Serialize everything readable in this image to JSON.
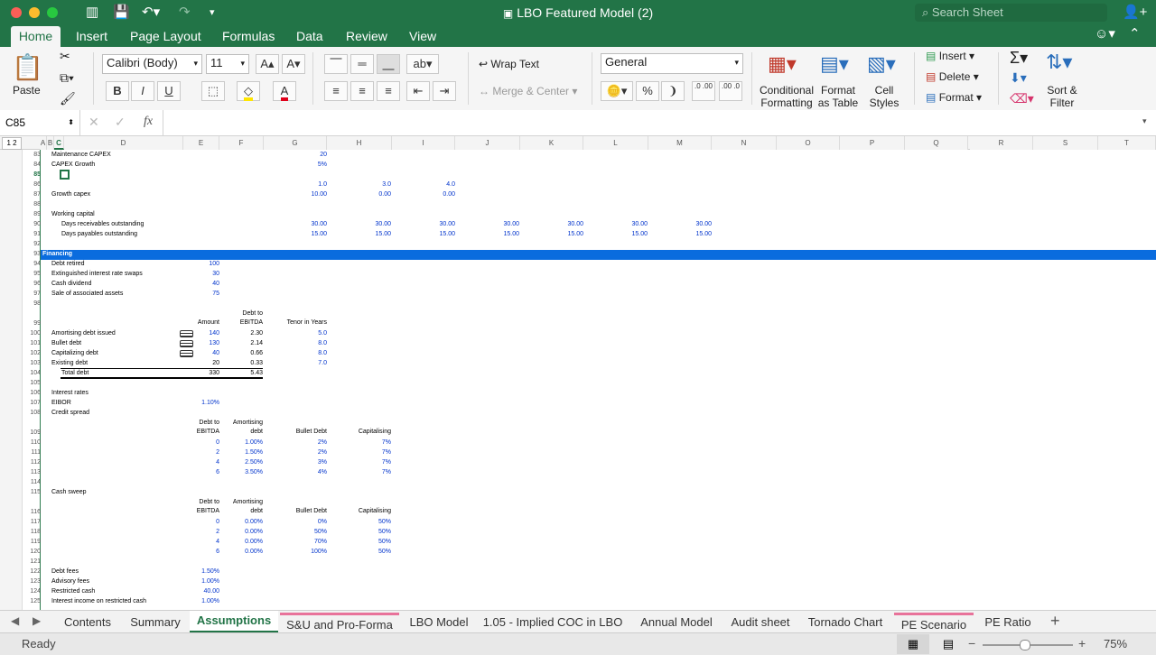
{
  "window": {
    "title": "LBO Featured Model (2)",
    "search_placeholder": "Search Sheet"
  },
  "ribbon_tabs": [
    "Home",
    "Insert",
    "Page Layout",
    "Formulas",
    "Data",
    "Review",
    "View"
  ],
  "ribbon": {
    "paste": "Paste",
    "font_name": "Calibri (Body)",
    "font_size": "11",
    "bold": "B",
    "italic": "I",
    "underline": "U",
    "wrap_text": "Wrap Text",
    "merge_center": "Merge & Center",
    "number_format": "General",
    "percent": "%",
    "comma": "❩",
    "inc_decimal": ".0 .00",
    "dec_decimal": ".00 .0",
    "conditional_formatting": [
      "Conditional",
      "Formatting"
    ],
    "format_as_table": [
      "Format",
      "as Table"
    ],
    "cell_styles": [
      "Cell",
      "Styles"
    ],
    "insert": "Insert",
    "delete": "Delete",
    "format": "Format",
    "sort_filter": [
      "Sort &",
      "Filter"
    ]
  },
  "formula_bar": {
    "name_box": "C85",
    "fx": "fx",
    "content": ""
  },
  "outline_levels": "1 2",
  "columns": [
    "A",
    "B",
    "C",
    "D",
    "E",
    "F",
    "G",
    "H",
    "I",
    "J",
    "K",
    "L",
    "M",
    "N",
    "O",
    "P",
    "Q",
    "R",
    "S",
    "T"
  ],
  "rows": [
    {
      "n": "83",
      "cells": [
        {
          "c": "D",
          "t": "Maintenance CAPEX"
        },
        {
          "c": "G",
          "t": "20",
          "blue": true
        }
      ]
    },
    {
      "n": "84",
      "cells": [
        {
          "c": "D",
          "t": "CAPEX Growth"
        },
        {
          "c": "G",
          "t": "5%",
          "blue": true
        }
      ]
    },
    {
      "n": "85",
      "cells": []
    },
    {
      "n": "86",
      "cells": [
        {
          "c": "G",
          "t": "1.0",
          "blue": true
        },
        {
          "c": "H",
          "t": "3.0",
          "blue": true
        },
        {
          "c": "I",
          "t": "4.0",
          "blue": true
        }
      ]
    },
    {
      "n": "87",
      "cells": [
        {
          "c": "D",
          "t": "Growth capex"
        },
        {
          "c": "G",
          "t": "10.00",
          "blue": true
        },
        {
          "c": "H",
          "t": "0.00",
          "blue": true
        },
        {
          "c": "I",
          "t": "0.00",
          "blue": true
        }
      ]
    },
    {
      "n": "88",
      "cells": []
    },
    {
      "n": "89",
      "cells": [
        {
          "c": "D",
          "t": "Working capital"
        }
      ]
    },
    {
      "n": "90",
      "cells": [
        {
          "c": "D2",
          "t": "Days receivables outstanding"
        },
        {
          "c": "G",
          "t": "30.00",
          "blue": true
        },
        {
          "c": "H",
          "t": "30.00",
          "blue": true
        },
        {
          "c": "I",
          "t": "30.00",
          "blue": true
        },
        {
          "c": "J",
          "t": "30.00",
          "blue": true
        },
        {
          "c": "K",
          "t": "30.00",
          "blue": true
        },
        {
          "c": "L",
          "t": "30.00",
          "blue": true
        },
        {
          "c": "M",
          "t": "30.00",
          "blue": true
        }
      ]
    },
    {
      "n": "91",
      "cells": [
        {
          "c": "D2",
          "t": "Days payables outstanding"
        },
        {
          "c": "G",
          "t": "15.00",
          "blue": true
        },
        {
          "c": "H",
          "t": "15.00",
          "blue": true
        },
        {
          "c": "I",
          "t": "15.00",
          "blue": true
        },
        {
          "c": "J",
          "t": "15.00",
          "blue": true
        },
        {
          "c": "K",
          "t": "15.00",
          "blue": true
        },
        {
          "c": "L",
          "t": "15.00",
          "blue": true
        },
        {
          "c": "M",
          "t": "15.00",
          "blue": true
        }
      ]
    },
    {
      "n": "92",
      "cells": []
    },
    {
      "n": "93",
      "header": "Financing",
      "cells": []
    },
    {
      "n": "94",
      "cells": [
        {
          "c": "D",
          "t": "Debt retired"
        },
        {
          "c": "E",
          "t": "100",
          "blue": true
        }
      ]
    },
    {
      "n": "95",
      "cells": [
        {
          "c": "D",
          "t": "Extinguished interest rate swaps"
        },
        {
          "c": "E",
          "t": "30",
          "blue": true
        }
      ]
    },
    {
      "n": "96",
      "cells": [
        {
          "c": "D",
          "t": "Cash dividend"
        },
        {
          "c": "E",
          "t": "40",
          "blue": true
        }
      ]
    },
    {
      "n": "97",
      "cells": [
        {
          "c": "D",
          "t": "Sale of associated assets"
        },
        {
          "c": "E",
          "t": "75",
          "blue": true
        }
      ]
    },
    {
      "n": "98",
      "cells": []
    },
    {
      "n": "99",
      "tall": true,
      "cells": [
        {
          "c": "E",
          "t": "Amount"
        },
        {
          "c": "F",
          "t": "Debt to"
        },
        {
          "c": "F2",
          "t": "EBITDA"
        },
        {
          "c": "G",
          "t": "Tenor in Years"
        }
      ]
    },
    {
      "n": "100",
      "cells": [
        {
          "c": "D",
          "t": "Amortising debt issued"
        },
        {
          "c": "E",
          "t": "140",
          "blue": true
        },
        {
          "c": "F",
          "t": "2.30"
        },
        {
          "c": "G",
          "t": "5.0",
          "blue": true
        }
      ]
    },
    {
      "n": "101",
      "cells": [
        {
          "c": "D",
          "t": "Bullet debt"
        },
        {
          "c": "E",
          "t": "130",
          "blue": true
        },
        {
          "c": "F",
          "t": "2.14"
        },
        {
          "c": "G",
          "t": "8.0",
          "blue": true
        }
      ]
    },
    {
      "n": "102",
      "cells": [
        {
          "c": "D",
          "t": "Capitalizing debt"
        },
        {
          "c": "E",
          "t": "40",
          "blue": true
        },
        {
          "c": "F",
          "t": "0.66"
        },
        {
          "c": "G",
          "t": "8.0",
          "blue": true
        }
      ]
    },
    {
      "n": "103",
      "cells": [
        {
          "c": "D",
          "t": "Existing debt"
        },
        {
          "c": "E",
          "t": "20"
        },
        {
          "c": "F",
          "t": "0.33"
        },
        {
          "c": "G",
          "t": "7.0",
          "blue": true
        }
      ]
    },
    {
      "n": "104",
      "total": true,
      "cells": [
        {
          "c": "D2",
          "t": "Total debt"
        },
        {
          "c": "E",
          "t": "330"
        },
        {
          "c": "F",
          "t": "5.43"
        }
      ]
    },
    {
      "n": "105",
      "cells": []
    },
    {
      "n": "106",
      "cells": [
        {
          "c": "D",
          "t": "Interest rates"
        }
      ]
    },
    {
      "n": "107",
      "cells": [
        {
          "c": "D",
          "t": "EIBOR"
        },
        {
          "c": "E",
          "t": "1.10%",
          "blue": true
        }
      ]
    },
    {
      "n": "108",
      "cells": [
        {
          "c": "D",
          "t": "Credit spread"
        }
      ]
    },
    {
      "n": "109",
      "tall": true,
      "cells": [
        {
          "c": "E",
          "t": "Debt to"
        },
        {
          "c": "E2",
          "t": "EBITDA"
        },
        {
          "c": "F",
          "t": "Amortising"
        },
        {
          "c": "F2",
          "t": "debt"
        },
        {
          "c": "G",
          "t": "Bullet Debt"
        },
        {
          "c": "H",
          "t": "Capitalising"
        }
      ]
    },
    {
      "n": "110",
      "cells": [
        {
          "c": "E",
          "t": "0",
          "blue": true
        },
        {
          "c": "F",
          "t": "1.00%",
          "blue": true
        },
        {
          "c": "G",
          "t": "2%",
          "blue": true
        },
        {
          "c": "H",
          "t": "7%",
          "blue": true
        }
      ]
    },
    {
      "n": "111",
      "cells": [
        {
          "c": "E",
          "t": "2",
          "blue": true
        },
        {
          "c": "F",
          "t": "1.50%",
          "blue": true
        },
        {
          "c": "G",
          "t": "2%",
          "blue": true
        },
        {
          "c": "H",
          "t": "7%",
          "blue": true
        }
      ]
    },
    {
      "n": "112",
      "cells": [
        {
          "c": "E",
          "t": "4",
          "blue": true
        },
        {
          "c": "F",
          "t": "2.50%",
          "blue": true
        },
        {
          "c": "G",
          "t": "3%",
          "blue": true
        },
        {
          "c": "H",
          "t": "7%",
          "blue": true
        }
      ]
    },
    {
      "n": "113",
      "cells": [
        {
          "c": "E",
          "t": "6",
          "blue": true
        },
        {
          "c": "F",
          "t": "3.50%",
          "blue": true
        },
        {
          "c": "G",
          "t": "4%",
          "blue": true
        },
        {
          "c": "H",
          "t": "7%",
          "blue": true
        }
      ]
    },
    {
      "n": "114",
      "cells": []
    },
    {
      "n": "115",
      "cells": [
        {
          "c": "D",
          "t": "Cash sweep"
        }
      ]
    },
    {
      "n": "116",
      "tall": true,
      "cells": [
        {
          "c": "E",
          "t": "Debt to"
        },
        {
          "c": "E2",
          "t": "EBITDA"
        },
        {
          "c": "F",
          "t": "Amortising"
        },
        {
          "c": "F2",
          "t": "debt"
        },
        {
          "c": "G",
          "t": "Bullet Debt"
        },
        {
          "c": "H",
          "t": "Capitalising"
        }
      ]
    },
    {
      "n": "117",
      "cells": [
        {
          "c": "E",
          "t": "0",
          "blue": true
        },
        {
          "c": "F",
          "t": "0.00%",
          "blue": true
        },
        {
          "c": "G",
          "t": "0%",
          "blue": true
        },
        {
          "c": "H",
          "t": "50%",
          "blue": true
        }
      ]
    },
    {
      "n": "118",
      "cells": [
        {
          "c": "E",
          "t": "2",
          "blue": true
        },
        {
          "c": "F",
          "t": "0.00%",
          "blue": true
        },
        {
          "c": "G",
          "t": "50%",
          "blue": true
        },
        {
          "c": "H",
          "t": "50%",
          "blue": true
        }
      ]
    },
    {
      "n": "119",
      "cells": [
        {
          "c": "E",
          "t": "4",
          "blue": true
        },
        {
          "c": "F",
          "t": "0.00%",
          "blue": true
        },
        {
          "c": "G",
          "t": "70%",
          "blue": true
        },
        {
          "c": "H",
          "t": "50%",
          "blue": true
        }
      ]
    },
    {
      "n": "120",
      "cells": [
        {
          "c": "E",
          "t": "6",
          "blue": true
        },
        {
          "c": "F",
          "t": "0.00%",
          "blue": true
        },
        {
          "c": "G",
          "t": "100%",
          "blue": true
        },
        {
          "c": "H",
          "t": "50%",
          "blue": true
        }
      ]
    },
    {
      "n": "121",
      "cells": []
    },
    {
      "n": "122",
      "cells": [
        {
          "c": "D",
          "t": "Debt fees"
        },
        {
          "c": "E",
          "t": "1.50%",
          "blue": true
        }
      ]
    },
    {
      "n": "123",
      "cells": [
        {
          "c": "D",
          "t": "Advisory fees"
        },
        {
          "c": "E",
          "t": "1.00%",
          "blue": true
        }
      ]
    },
    {
      "n": "124",
      "cells": [
        {
          "c": "D",
          "t": "Restricted cash"
        },
        {
          "c": "E",
          "t": "40.00",
          "blue": true
        }
      ]
    },
    {
      "n": "125",
      "cells": [
        {
          "c": "D",
          "t": "Interest income on restricted cash"
        },
        {
          "c": "E",
          "t": "1.00%",
          "blue": true
        }
      ]
    }
  ],
  "sheet_tabs": [
    "Contents",
    "Summary",
    "Assumptions",
    "S&U and Pro-Forma",
    "LBO Model",
    "1.05 - Implied COC in LBO",
    "Annual Model",
    "Audit sheet",
    "Tornado Chart",
    "PE Scenario",
    "PE Ratio"
  ],
  "active_sheet": "Assumptions",
  "status": {
    "ready": "Ready",
    "zoom": "75%"
  },
  "colors": {
    "accent": "#227447",
    "section_header": "#0a6cde",
    "input_blue": "#0033cc",
    "tab_pink": "#e8729a"
  }
}
